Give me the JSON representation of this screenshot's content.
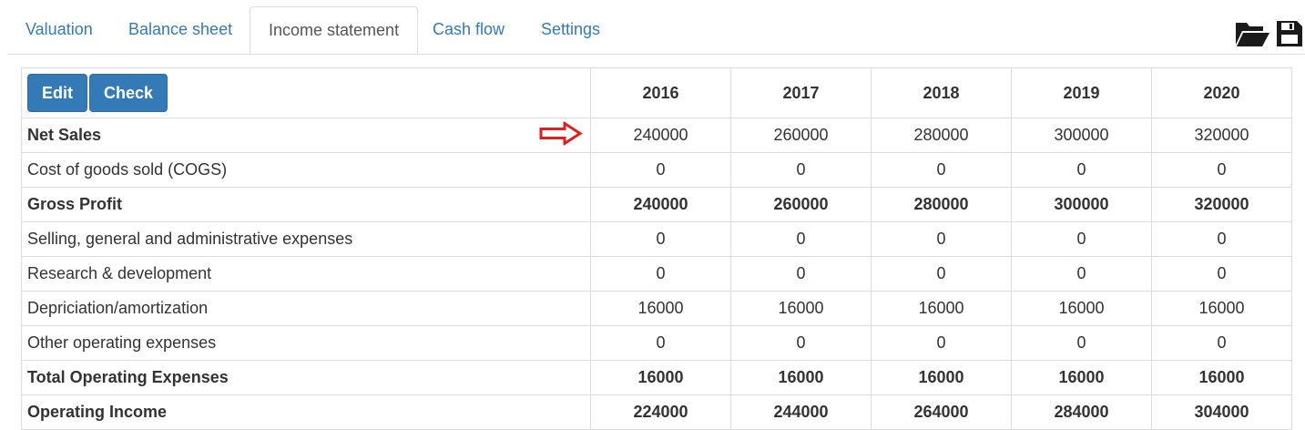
{
  "tabs": [
    {
      "label": "Valuation"
    },
    {
      "label": "Balance sheet"
    },
    {
      "label": "Income statement"
    },
    {
      "label": "Cash flow"
    },
    {
      "label": "Settings"
    }
  ],
  "active_tab": "Income statement",
  "toolbar": {
    "open_icon": "folder-open-icon",
    "save_icon": "save-icon"
  },
  "buttons": {
    "edit": "Edit",
    "check": "Check"
  },
  "years": [
    "2016",
    "2017",
    "2018",
    "2019",
    "2020"
  ],
  "rows": [
    {
      "label": "Net Sales",
      "bold": true,
      "values": [
        "240000",
        "260000",
        "280000",
        "300000",
        "320000"
      ]
    },
    {
      "label": "Cost of goods sold (COGS)",
      "bold": false,
      "values": [
        "0",
        "0",
        "0",
        "0",
        "0"
      ]
    },
    {
      "label": "Gross Profit",
      "bold": true,
      "values": [
        "240000",
        "260000",
        "280000",
        "300000",
        "320000"
      ]
    },
    {
      "label": "Selling, general and administrative expenses",
      "bold": false,
      "values": [
        "0",
        "0",
        "0",
        "0",
        "0"
      ]
    },
    {
      "label": "Research & development",
      "bold": false,
      "values": [
        "0",
        "0",
        "0",
        "0",
        "0"
      ]
    },
    {
      "label": "Depriciation/amortization",
      "bold": false,
      "values": [
        "16000",
        "16000",
        "16000",
        "16000",
        "16000"
      ]
    },
    {
      "label": "Other operating expenses",
      "bold": false,
      "values": [
        "0",
        "0",
        "0",
        "0",
        "0"
      ]
    },
    {
      "label": "Total Operating Expenses",
      "bold": true,
      "values": [
        "16000",
        "16000",
        "16000",
        "16000",
        "16000"
      ]
    },
    {
      "label": "Operating Income",
      "bold": true,
      "values": [
        "224000",
        "244000",
        "264000",
        "284000",
        "304000"
      ]
    }
  ],
  "colors": {
    "link": "#337ab7",
    "button": "#337ab7",
    "arrow": "#e02020",
    "border": "#dddddd"
  }
}
